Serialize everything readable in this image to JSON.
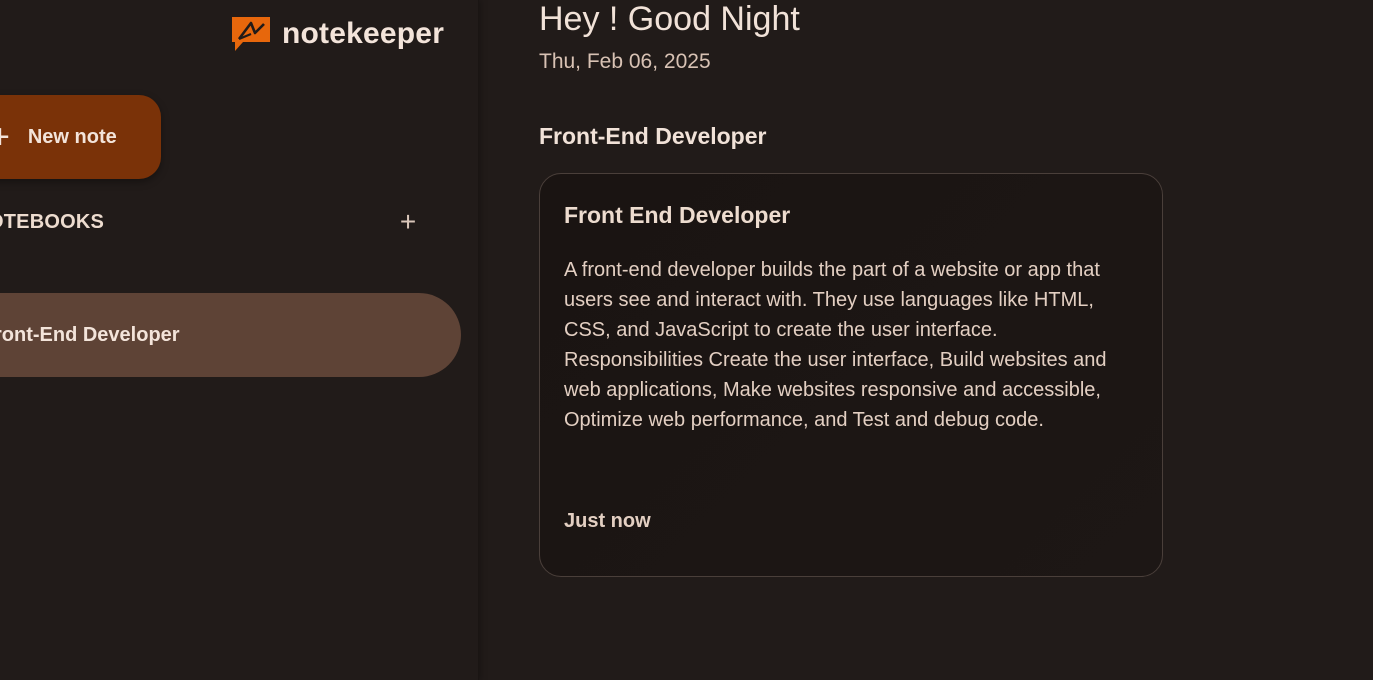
{
  "app": {
    "name": "notekeeper",
    "logo_icon": "note-bubble-icon",
    "accent": "#e7670c"
  },
  "sidebar": {
    "new_note_label": "New note",
    "new_note_icon": "plus-icon",
    "notebooks_title": "OTEBOOKS",
    "add_notebook_icon": "plus-icon",
    "items": [
      {
        "label": "ront-End Developer",
        "active": true
      }
    ]
  },
  "main": {
    "greeting": "Hey ! Good Night",
    "date": "Thu, Feb 06, 2025",
    "section_title": "Front-End Developer",
    "notes": [
      {
        "title": "Front End Developer",
        "text": "A front-end developer builds the part of a website or app that users see and interact with. They use languages like HTML, CSS, and JavaScript to create the user interface. Responsibilities Create the user interface, Build websites and web applications, Make websites responsive and accessible, Optimize web performance, and Test and debug code.",
        "time": "Just now"
      }
    ]
  },
  "colors": {
    "background": "#211b19",
    "new_note_button": "#7a3208",
    "active_nav": "#5e4336",
    "card_border": "#4a3f3a"
  }
}
